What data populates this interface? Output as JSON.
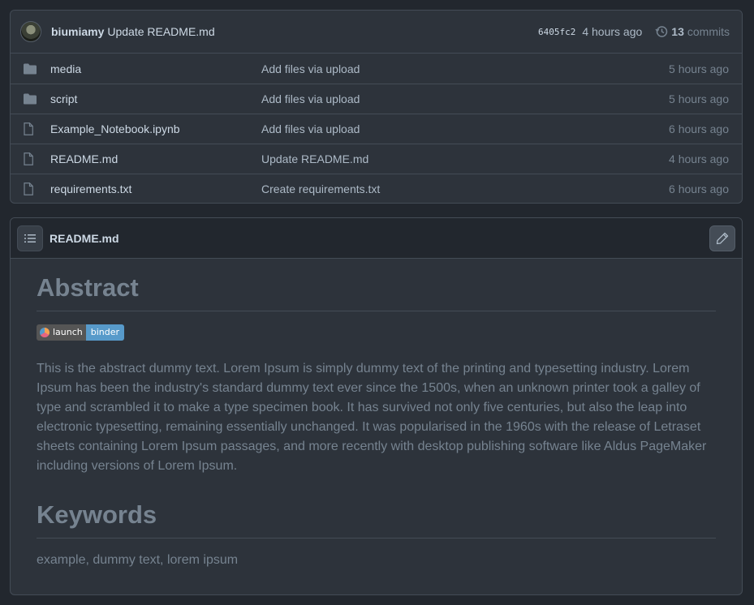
{
  "commit": {
    "author": "biumiamy",
    "message": "Update README.md",
    "sha": "6405fc2",
    "time": "4 hours ago",
    "commits_count": "13",
    "commits_label": "commits"
  },
  "files": [
    {
      "name": "media",
      "type": "folder",
      "message": "Add files via upload",
      "time": "5 hours ago"
    },
    {
      "name": "script",
      "type": "folder",
      "message": "Add files via upload",
      "time": "5 hours ago"
    },
    {
      "name": "Example_Notebook.ipynb",
      "type": "file",
      "message": "Add files via upload",
      "time": "6 hours ago"
    },
    {
      "name": "README.md",
      "type": "file",
      "message": "Update README.md",
      "time": "4 hours ago"
    },
    {
      "name": "requirements.txt",
      "type": "file",
      "message": "Create requirements.txt",
      "time": "6 hours ago"
    }
  ],
  "readme": {
    "filename": "README.md",
    "heading1": "Abstract",
    "badge_left": "launch",
    "badge_right": "binder",
    "abstract": "This is the abstract dummy text. Lorem Ipsum is simply dummy text of the printing and typesetting industry. Lorem Ipsum has been the industry's standard dummy text ever since the 1500s, when an unknown printer took a galley of type and scrambled it to make a type specimen book. It has survived not only five centuries, but also the leap into electronic typesetting, remaining essentially unchanged. It was popularised in the 1960s with the release of Letraset sheets containing Lorem Ipsum passages, and more recently with desktop publishing software like Aldus PageMaker including versions of Lorem Ipsum.",
    "heading2": "Keywords",
    "keywords": "example, dummy text, lorem ipsum"
  },
  "icons": {
    "folder": "folder-icon",
    "file": "file-icon",
    "history": "history-icon",
    "toc": "list-icon",
    "edit": "pencil-icon"
  },
  "colors": {
    "background": "#22272e",
    "panel": "#2d333b",
    "border": "#444c56",
    "badge_blue": "#579aca"
  }
}
